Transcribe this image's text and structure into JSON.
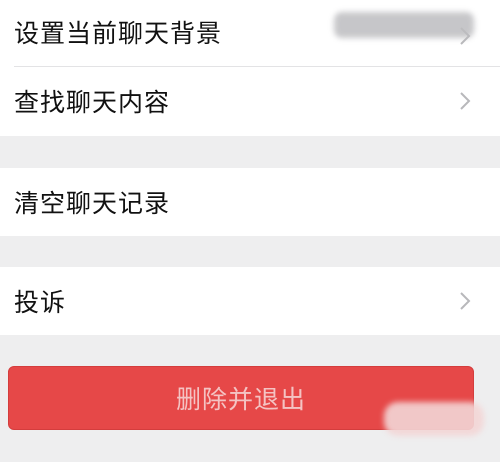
{
  "settings_list": {
    "rows": [
      {
        "label": "设置当前聊天背景",
        "has_chevron": true
      },
      {
        "label": "查找聊天内容",
        "has_chevron": true
      },
      {
        "label": "清空聊天记录",
        "has_chevron": false
      },
      {
        "label": "投诉",
        "has_chevron": true
      }
    ]
  },
  "danger_button": {
    "label": "删除并退出",
    "color": "#e64848"
  },
  "icons": {
    "chevron": "chevron-right-icon"
  },
  "colors": {
    "background": "#eeeeef",
    "row_background": "#ffffff",
    "text": "#111111",
    "chevron": "#b8b8bb"
  }
}
